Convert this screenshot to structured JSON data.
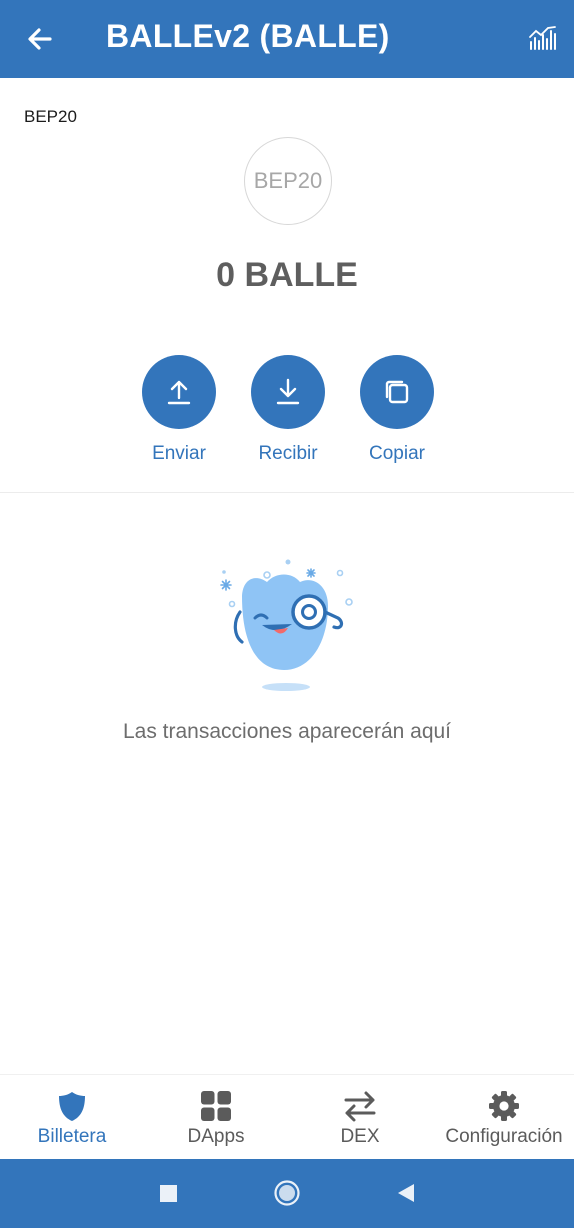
{
  "header": {
    "title": "BALLEv2 (BALLE)",
    "back_icon": "arrow-left-icon",
    "chart_icon": "chart-bars-icon"
  },
  "token": {
    "network": "BEP20",
    "logo_text": "BEP20",
    "balance": "0 BALLE"
  },
  "actions": [
    {
      "label": "Enviar",
      "icon": "upload-arrow-icon"
    },
    {
      "label": "Recibir",
      "icon": "download-arrow-icon"
    },
    {
      "label": "Copiar",
      "icon": "copy-icon"
    }
  ],
  "transactions": {
    "empty_message": "Las transacciones aparecerán aquí"
  },
  "bottom_nav": {
    "items": [
      {
        "label": "Billetera",
        "icon": "shield-icon",
        "active": true
      },
      {
        "label": "DApps",
        "icon": "grid-icon",
        "active": false
      },
      {
        "label": "DEX",
        "icon": "swap-arrows-icon",
        "active": false
      },
      {
        "label": "Configuración",
        "icon": "gear-icon",
        "active": false
      }
    ]
  },
  "system_nav": {
    "icons": [
      "recents-square-icon",
      "home-circle-icon",
      "back-triangle-icon"
    ]
  },
  "colors": {
    "brand": "#3375bb",
    "nav_inactive": "#5b5b5b",
    "illustration": "#8fc4f5"
  }
}
